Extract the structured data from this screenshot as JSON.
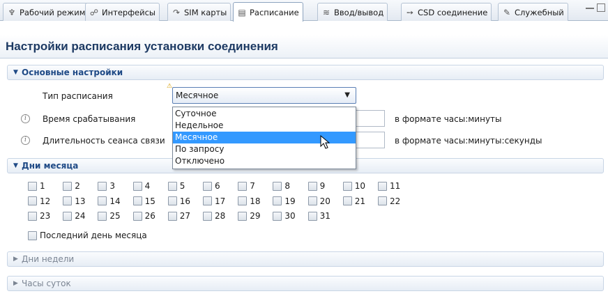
{
  "tabs": [
    {
      "label": "Рабочий режим",
      "icon": "work-mode-icon",
      "glyph": "♆",
      "active": false
    },
    {
      "label": "Интерфейсы",
      "icon": "interfaces-icon",
      "glyph": "☍",
      "active": false
    },
    {
      "label": "SIM карты",
      "icon": "sim-icon",
      "glyph": "↷",
      "active": false
    },
    {
      "label": "Расписание",
      "icon": "schedule-icon",
      "glyph": "▤",
      "active": true
    },
    {
      "label": "Ввод/вывод",
      "icon": "io-icon",
      "glyph": "≋",
      "active": false
    },
    {
      "label": "CSD соединение",
      "icon": "arrow-right-icon",
      "glyph": "➙",
      "active": false
    },
    {
      "label": "Служебный",
      "icon": "wrench-icon",
      "glyph": "✎",
      "active": false
    }
  ],
  "form": {
    "title": "Настройки расписания установки соединения"
  },
  "basic": {
    "header": "Основные настройки",
    "schedule_type_label": "Тип расписания",
    "schedule_type_value": "Месячное",
    "trigger_time_label": "Время срабатывания",
    "trigger_time_hint": "в формате часы:минуты",
    "session_duration_label": "Длительность сеанса связи",
    "session_duration_hint": "в формате часы:минуты:секунды"
  },
  "dropdown_options": [
    "Суточное",
    "Недельное",
    "Месячное",
    "По запросу",
    "Отключено"
  ],
  "dropdown_selected_index": 2,
  "month_days": {
    "header": "Дни месяца",
    "days": [
      "1",
      "2",
      "3",
      "4",
      "5",
      "6",
      "7",
      "8",
      "9",
      "10",
      "11",
      "12",
      "13",
      "14",
      "15",
      "16",
      "17",
      "18",
      "19",
      "20",
      "21",
      "22",
      "23",
      "24",
      "25",
      "26",
      "27",
      "28",
      "29",
      "30",
      "31"
    ],
    "last_day_label": "Последний день месяца"
  },
  "week_days": {
    "header": "Дни недели"
  },
  "day_hours": {
    "header": "Часы суток"
  },
  "colors": {
    "accent": "#1f4a86",
    "selection": "#3399ff",
    "title": "#1d3a63"
  }
}
